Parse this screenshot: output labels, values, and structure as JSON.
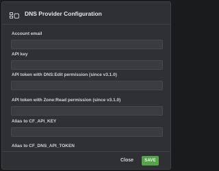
{
  "dialog": {
    "title": "DNS Provider Configuration",
    "icon": "dns-provider-icon"
  },
  "fields": [
    {
      "label": "Account email",
      "value": ""
    },
    {
      "label": "API key",
      "value": ""
    },
    {
      "label": "API token with DNS:Edit permission (since v3.1.0)",
      "value": ""
    },
    {
      "label": "API token with Zone:Read permission (since v3.1.0)",
      "value": ""
    },
    {
      "label": "Alias to CF_API_KEY",
      "value": ""
    },
    {
      "label": "Alias to CF_DNS_API_TOKEN",
      "value": ""
    }
  ],
  "footer": {
    "close_label": "Close",
    "save_label": "SAVE"
  },
  "colors": {
    "accent": "#52a447",
    "dialog_background": "#2f3033",
    "input_background": "#3a3c40"
  }
}
